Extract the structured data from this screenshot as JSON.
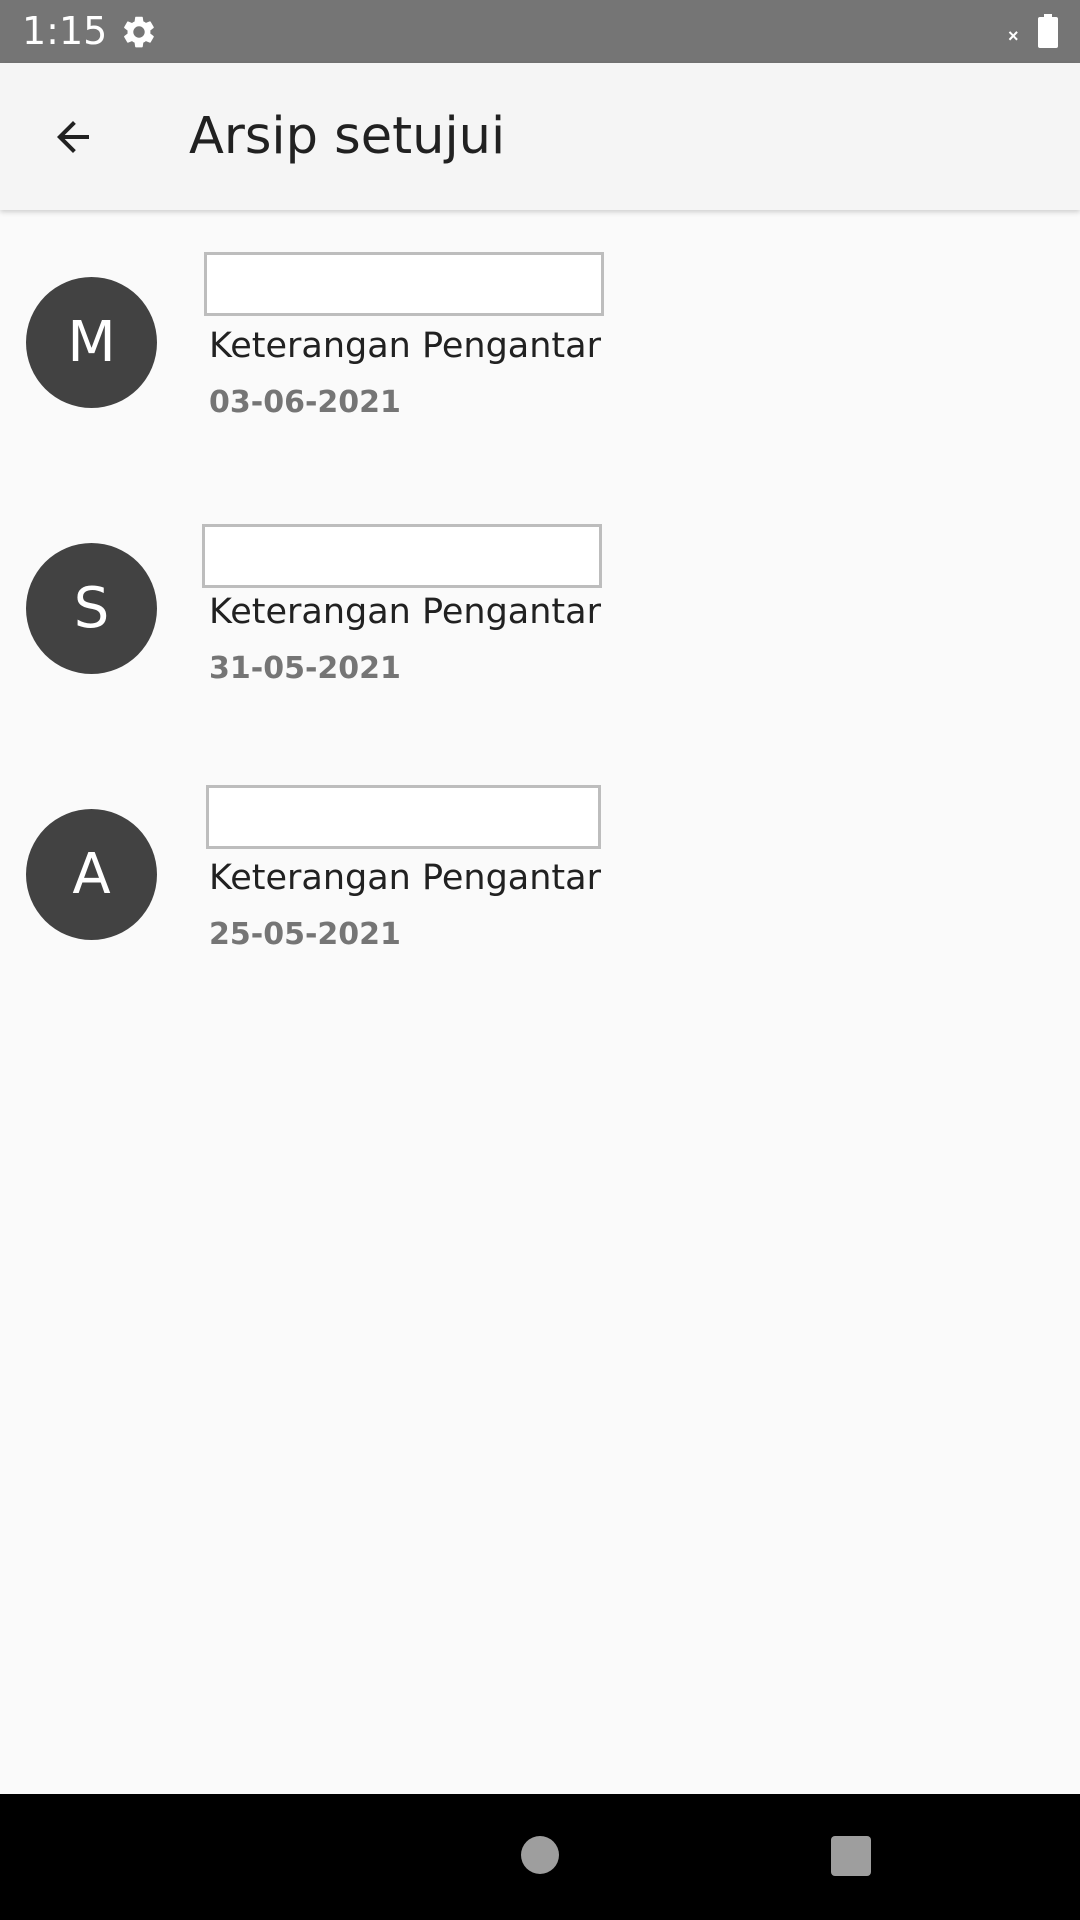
{
  "status_bar": {
    "time": "1:15",
    "icons": [
      "gear-icon",
      "no-signal-icon",
      "battery-icon"
    ],
    "no_signal_glyph": "×"
  },
  "app_bar": {
    "title": "Arsip setujui",
    "back_icon": "arrow-left-icon"
  },
  "items": [
    {
      "initial": "M",
      "name": "",
      "subtitle": "Keterangan Pengantar",
      "date": "03-06-2021"
    },
    {
      "initial": "S",
      "name": "",
      "subtitle": "Keterangan Pengantar",
      "date": "31-05-2021"
    },
    {
      "initial": "A",
      "name": "",
      "subtitle": "Keterangan Pengantar",
      "date": "25-05-2021"
    }
  ],
  "nav_bar": {
    "icons": [
      "home-icon",
      "recents-icon"
    ]
  },
  "colors": {
    "status_bar": "#757575",
    "app_bar": "#f5f5f5",
    "background": "#fafafa",
    "avatar": "#424242",
    "date_text": "#757575",
    "nav_bar": "#000000"
  }
}
